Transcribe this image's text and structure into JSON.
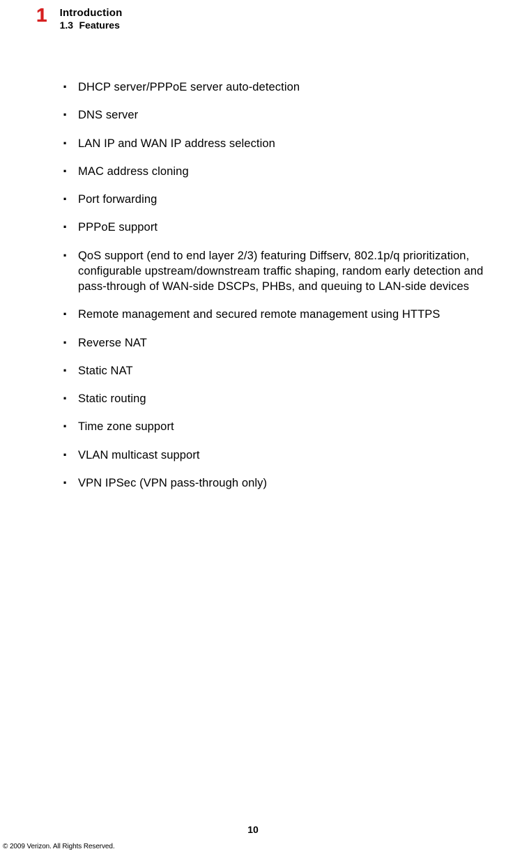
{
  "header": {
    "chapter_number": "1",
    "chapter_title": "Introduction",
    "section_number": "1.3",
    "section_title": "Features"
  },
  "features": [
    "DHCP server/PPPoE server auto-detection",
    "DNS server",
    "LAN IP and WAN IP address selection",
    "MAC address cloning",
    "Port forwarding",
    "PPPoE support",
    "QoS support (end to end layer 2/3) featuring Diffserv, 802.1p/q prioritization, configurable upstream/downstream traffic shaping, random early detection and pass-through of WAN-side DSCPs, PHBs, and queuing to LAN-side devices",
    "Remote management and secured remote management using HTTPS",
    "Reverse NAT",
    "Static NAT",
    "Static routing",
    "Time zone support",
    "VLAN multicast support",
    "VPN IPSec (VPN pass-through only)"
  ],
  "footer": {
    "page_number": "10",
    "copyright": "© 2009 Verizon. All Rights Reserved."
  }
}
